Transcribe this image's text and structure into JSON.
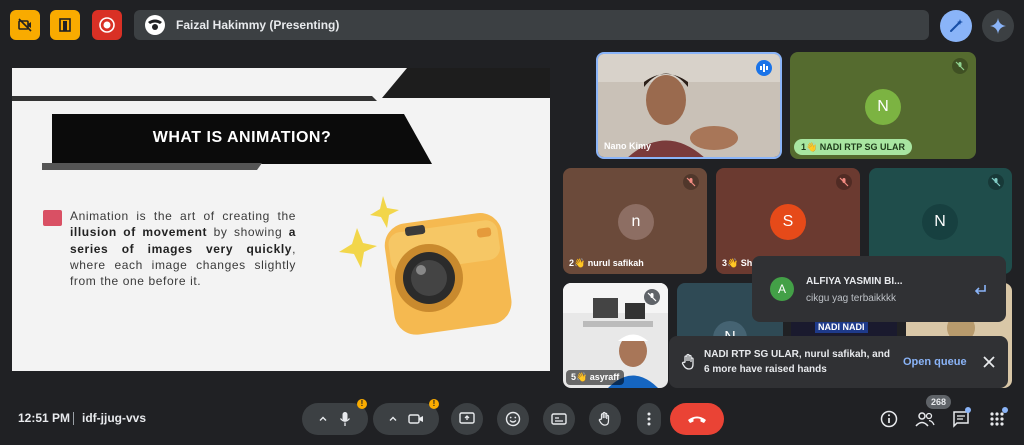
{
  "topbar": {
    "presenter_label": "Faizal Hakimmy (Presenting)"
  },
  "slide": {
    "title": "WHAT IS ANIMATION?",
    "text_parts": [
      {
        "text": "Animation is the art of creating the ",
        "bold": false
      },
      {
        "text": "illusion of movement",
        "bold": true
      },
      {
        "text": " by showing ",
        "bold": false
      },
      {
        "text": "a series of images very quickly",
        "bold": true
      },
      {
        "text": ", where each image changes slightly from the one before it.",
        "bold": false
      }
    ]
  },
  "tiles": {
    "nano": {
      "name": "Nano Kimy"
    },
    "nadi": {
      "initial": "N",
      "label": "1👋 NADI RTP SG ULAR"
    },
    "nurul": {
      "initial": "n",
      "label": "2👋 nurul safikah"
    },
    "sh": {
      "initial": "S",
      "label": "3👋 Sh"
    },
    "teal": {
      "initial": "N"
    },
    "asyraff": {
      "label": "5👋 asyraff"
    },
    "small_a": {
      "initial": "N"
    },
    "small_b_text": "NADI NADI"
  },
  "chat_toast": {
    "initial": "A",
    "name": "ALFIYA YASMIN BI...",
    "message": "cikgu yag terbaikkkk"
  },
  "hands_toast": {
    "text": "NADI RTP SG ULAR, nurul safikah, and 6 more have raised hands",
    "action": "Open queue"
  },
  "bottombar": {
    "time": "12:51 PM",
    "meeting_code": "idf-jjug-vvs",
    "participant_count": "268"
  },
  "colors": {
    "accent_blue": "#8ab4f8",
    "hangup_red": "#ea4335",
    "warning_yellow": "#f9ab00",
    "tile_green": "#556b2f",
    "tile_brown": "#6b4a3a",
    "tile_teal": "#1f4d4b"
  }
}
